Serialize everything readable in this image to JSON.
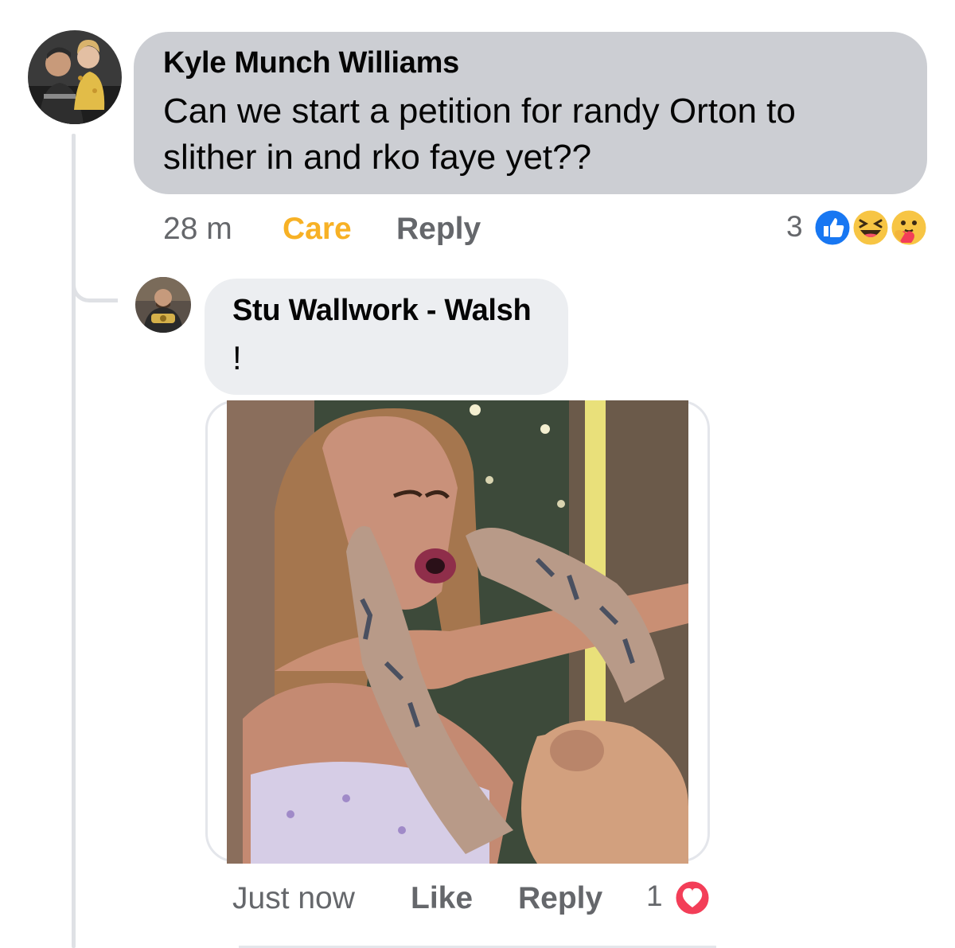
{
  "comment": {
    "author": "Kyle Munch Williams",
    "text_line1": "Can we start a petition for randy Orton to",
    "text_line2": "slither in and rko faye yet??",
    "time": "28 m",
    "reaction_action": "Care",
    "reply_label": "Reply",
    "reaction_count": "3",
    "reaction_icons": [
      "like-icon",
      "haha-icon",
      "care-icon"
    ],
    "accent_color": "#f7b125"
  },
  "reply": {
    "author": "Stu Wallwork - Walsh",
    "text": "!",
    "image_description_icon": "meme-photo",
    "time": "Just now",
    "like_label": "Like",
    "reply_label": "Reply",
    "reaction_count": "1",
    "reaction_icons": [
      "love-icon"
    ]
  },
  "colors": {
    "bubble_primary": "#ccced3",
    "bubble_secondary": "#eceef1",
    "meta_text": "#65676b",
    "like_blue": "#1877f2",
    "love_red": "#f33e58"
  }
}
